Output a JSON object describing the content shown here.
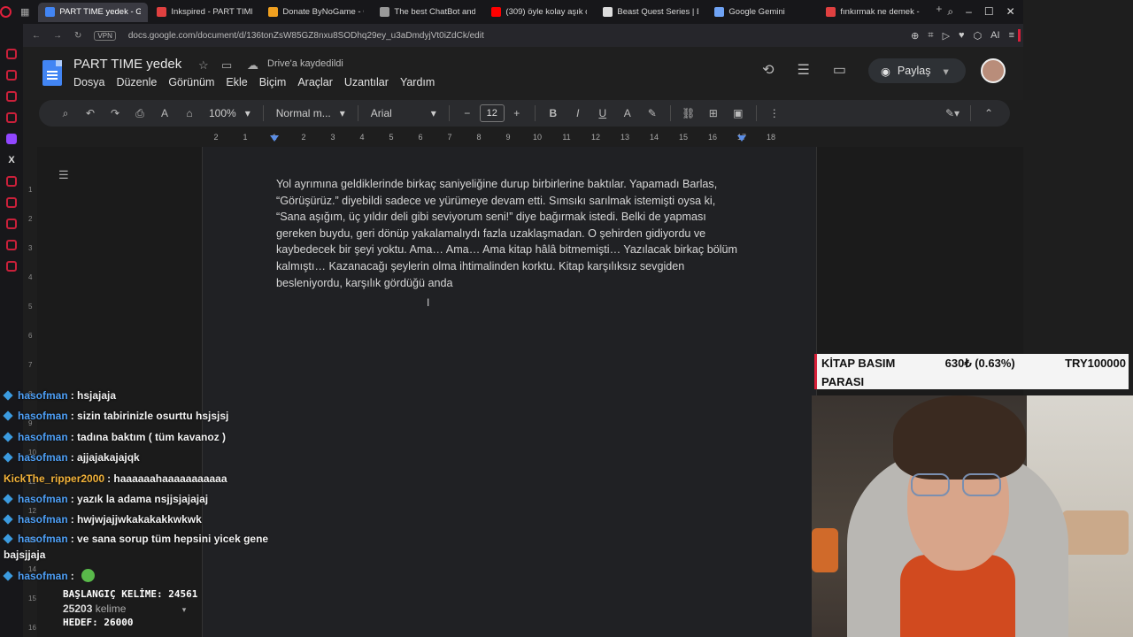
{
  "browser": {
    "tabs": [
      {
        "label": "PART TIME yedek - Google",
        "active": true,
        "color": "#4285f4"
      },
      {
        "label": "Inkspired - PART TIME",
        "color": "#e04040"
      },
      {
        "label": "Donate ByNoGame - G",
        "color": "#f0a020"
      },
      {
        "label": "The best ChatBot and",
        "color": "#999999"
      },
      {
        "label": "(309) öyle kolay aşık o",
        "color": "#ff0000"
      },
      {
        "label": "Beast Quest Series | B",
        "color": "#dddddd"
      },
      {
        "label": "Google Gemini",
        "color": "#6fa3f5"
      },
      {
        "label": "fınkırmak ne demek - G",
        "color": "#e04040"
      }
    ],
    "vpn": "VPN",
    "url": "docs.google.com/document/d/136tonZsW85GZ8nxu8SODhq29ey_u3aDmdyjVt0iZdCk/edit",
    "ai_label": "AI"
  },
  "docs": {
    "title": "PART TIME  yedek",
    "saved_status": "Drive'a kaydedildi",
    "menus": [
      "Dosya",
      "Düzenle",
      "Görünüm",
      "Ekle",
      "Biçim",
      "Araçlar",
      "Uzantılar",
      "Yardım"
    ],
    "share_label": "Paylaş",
    "zoom": "100%",
    "style": "Normal m...",
    "font": "Arial",
    "font_size": "12",
    "ruler_labels": [
      "2",
      "1",
      "1",
      "2",
      "3",
      "4",
      "5",
      "6",
      "7",
      "8",
      "9",
      "10",
      "11",
      "12",
      "13",
      "14",
      "15",
      "16",
      "17",
      "18"
    ],
    "vruler_labels": [
      "1",
      "2",
      "3",
      "4",
      "5",
      "6",
      "7",
      "8",
      "9",
      "10",
      "11",
      "12",
      "13",
      "14",
      "15",
      "16"
    ],
    "body_text": "Yol ayrımına geldiklerinde birkaç saniyeliğine durup birbirlerine baktılar. Yapamadı Barlas, “Görüşürüz.” diyebildi sadece ve yürümeye devam etti. Sımsıkı sarılmak istemişti oysa ki, “Sana aşığım, üç yıldır deli gibi seviyorum seni!” diye bağırmak istedi. Belki de yapması gereken buydu, geri dönüp yakalamalıydı fazla uzaklaşmadan. O şehirden gidiyordu ve kaybedecek bir şeyi yoktu. Ama… Ama… Ama kitap hâlâ bitmemişti… Yazılacak birkaç bölüm kalmıştı… Kazanacağı şeylerin olma ihtimalinden korktu. Kitap karşılıksız sevgiden besleniyordu, karşılık gördüğü anda"
  },
  "chat": {
    "messages": [
      {
        "user": "hasofman",
        "text": ": hsjajaja",
        "badge": true
      },
      {
        "user": "hasofman",
        "text": ": sizin tabirinizle osurttu hsjsjsj",
        "badge": true
      },
      {
        "user": "hasofman",
        "text": ": tadına baktım ( tüm kavanoz )",
        "badge": true
      },
      {
        "user": "hasofman",
        "text": ": ajjajakajajqk",
        "badge": true
      },
      {
        "user": "KickThe_ripper2000",
        "text": ": haaaaaahaaaaaaaaaaa",
        "badge": false,
        "orange": true
      },
      {
        "user": "hasofman",
        "text": ": yazık la adama nsjjsjajajaj",
        "badge": true
      },
      {
        "user": "hasofman",
        "text": ": hwjwjajjwkakakakkwkwk",
        "badge": true
      },
      {
        "user": "hasofman",
        "text": ": ve sana sorup tüm hepsini yicek gene bajsjjaja",
        "badge": true,
        "wrap": true
      },
      {
        "user": "hasofman",
        "text": ":",
        "badge": true,
        "emote": true
      }
    ]
  },
  "counters": {
    "start_label": "BAŞLANGIÇ KELİME: 24561",
    "word_count_number": "25203",
    "word_count_unit": "kelime",
    "target_label": "HEDEF: 26000"
  },
  "ticker": {
    "label_line1": "KİTAP BASIM",
    "label_line2": "PARASI",
    "amount": "630₺ (0.63%)",
    "goal": "TRY100000"
  }
}
